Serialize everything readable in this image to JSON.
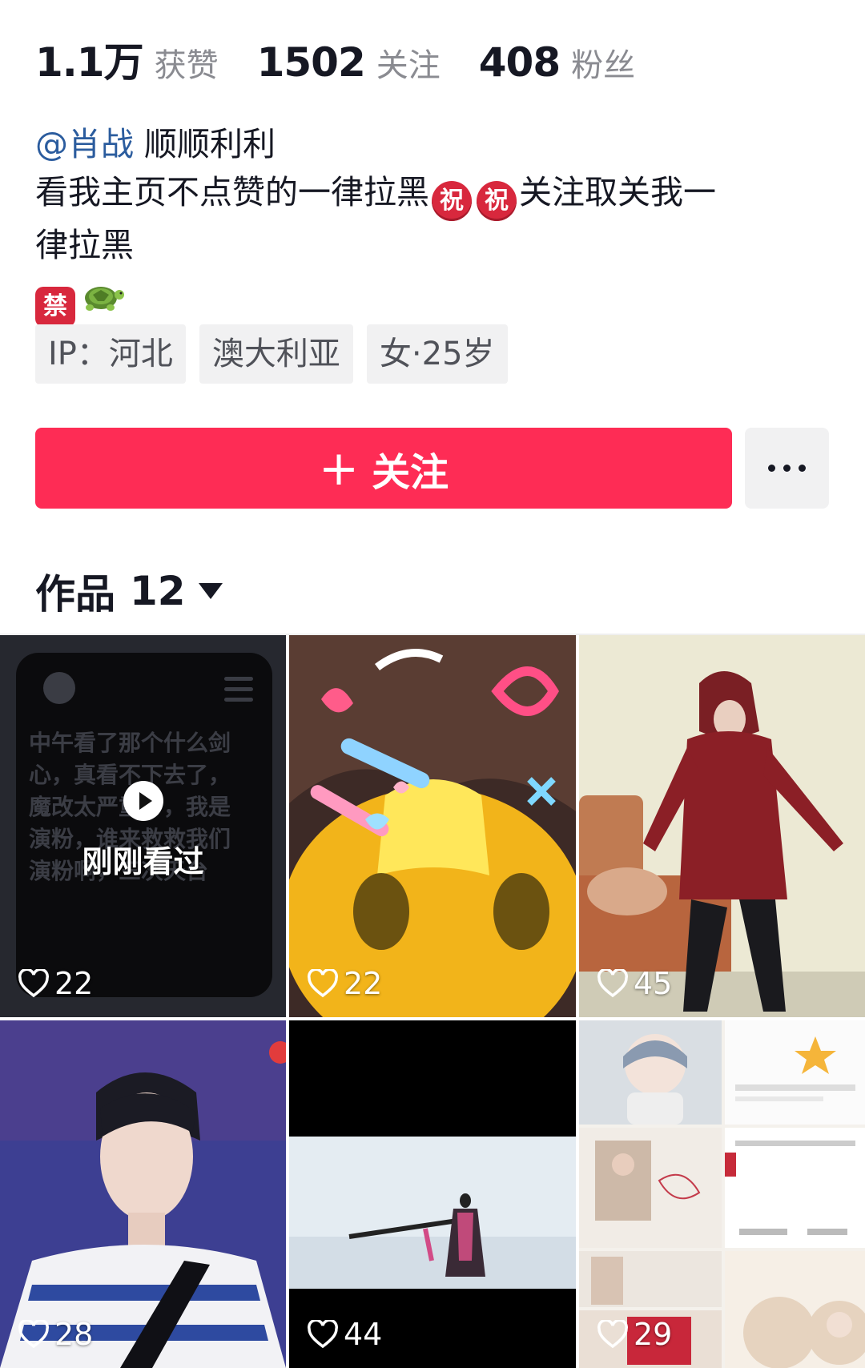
{
  "stats": [
    {
      "value": "1.1万",
      "label": "获赞"
    },
    {
      "value": "1502",
      "label": "关注"
    },
    {
      "value": "408",
      "label": "粉丝"
    }
  ],
  "bio": {
    "mention": "@肖战",
    "line1_rest": " 顺顺利利",
    "line2_a": "看我主页不点赞的一律拉黑",
    "emoji_zhu": "祝",
    "line2_b": "关注取关我一",
    "line3": "律拉黑",
    "emoji_jin": "禁",
    "turtle_icon": "turtle-icon"
  },
  "tags": [
    "IP：河北",
    "澳大利亚",
    "女·25岁"
  ],
  "actions": {
    "follow_label": "关注",
    "more_icon": "more-dots-icon"
  },
  "works": {
    "label": "作品",
    "count": "12"
  },
  "videos": [
    {
      "likes": "22",
      "overlay": "刚刚看过",
      "post_text": "中午看了那个什么剑心，真看不下去了，魔改太严重了，我是演粉，谁来救救我们演粉啊，三次天台"
    },
    {
      "likes": "22"
    },
    {
      "likes": "45"
    },
    {
      "likes": "28"
    },
    {
      "likes": "44"
    },
    {
      "likes": "29"
    }
  ],
  "colors": {
    "accent": "#fe2c55",
    "mention": "#2b5c9e"
  }
}
